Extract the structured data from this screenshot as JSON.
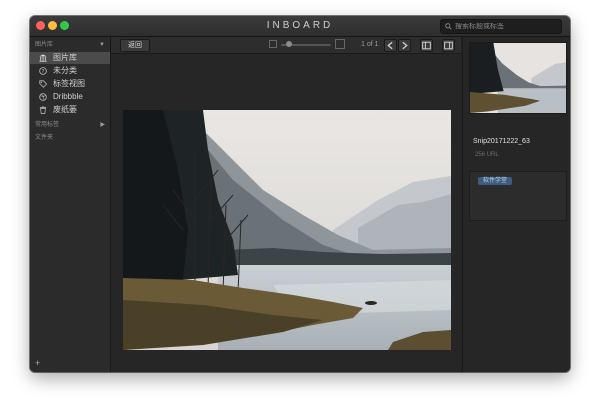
{
  "window": {
    "app_title": "INBOARD",
    "search_placeholder": "搜索标题或标签"
  },
  "sidebar": {
    "library_header": "图片库",
    "items": [
      {
        "label": "图片库",
        "icon": "library-icon",
        "active": true
      },
      {
        "label": "未分类",
        "icon": "question-icon",
        "active": false
      },
      {
        "label": "标签视图",
        "icon": "tag-icon",
        "active": false
      },
      {
        "label": "Dribbble",
        "icon": "dribbble-icon",
        "active": false
      },
      {
        "label": "废纸篓",
        "icon": "trash-icon",
        "active": false
      }
    ],
    "tags_header": "常用标签",
    "folders_header": "文件夹",
    "add_label": "+"
  },
  "toolbar": {
    "back_label": "返回",
    "page_count": "1 of 1",
    "zoom_fraction": 0.15
  },
  "inspector": {
    "file_name": "Snip20171222_63",
    "file_meta": "256 URL",
    "tag": "软件学堂"
  },
  "colors": {
    "window_bg": "#232323",
    "sidebar_active": "#4b4b4b",
    "tag_chip": "#3d5c80"
  }
}
